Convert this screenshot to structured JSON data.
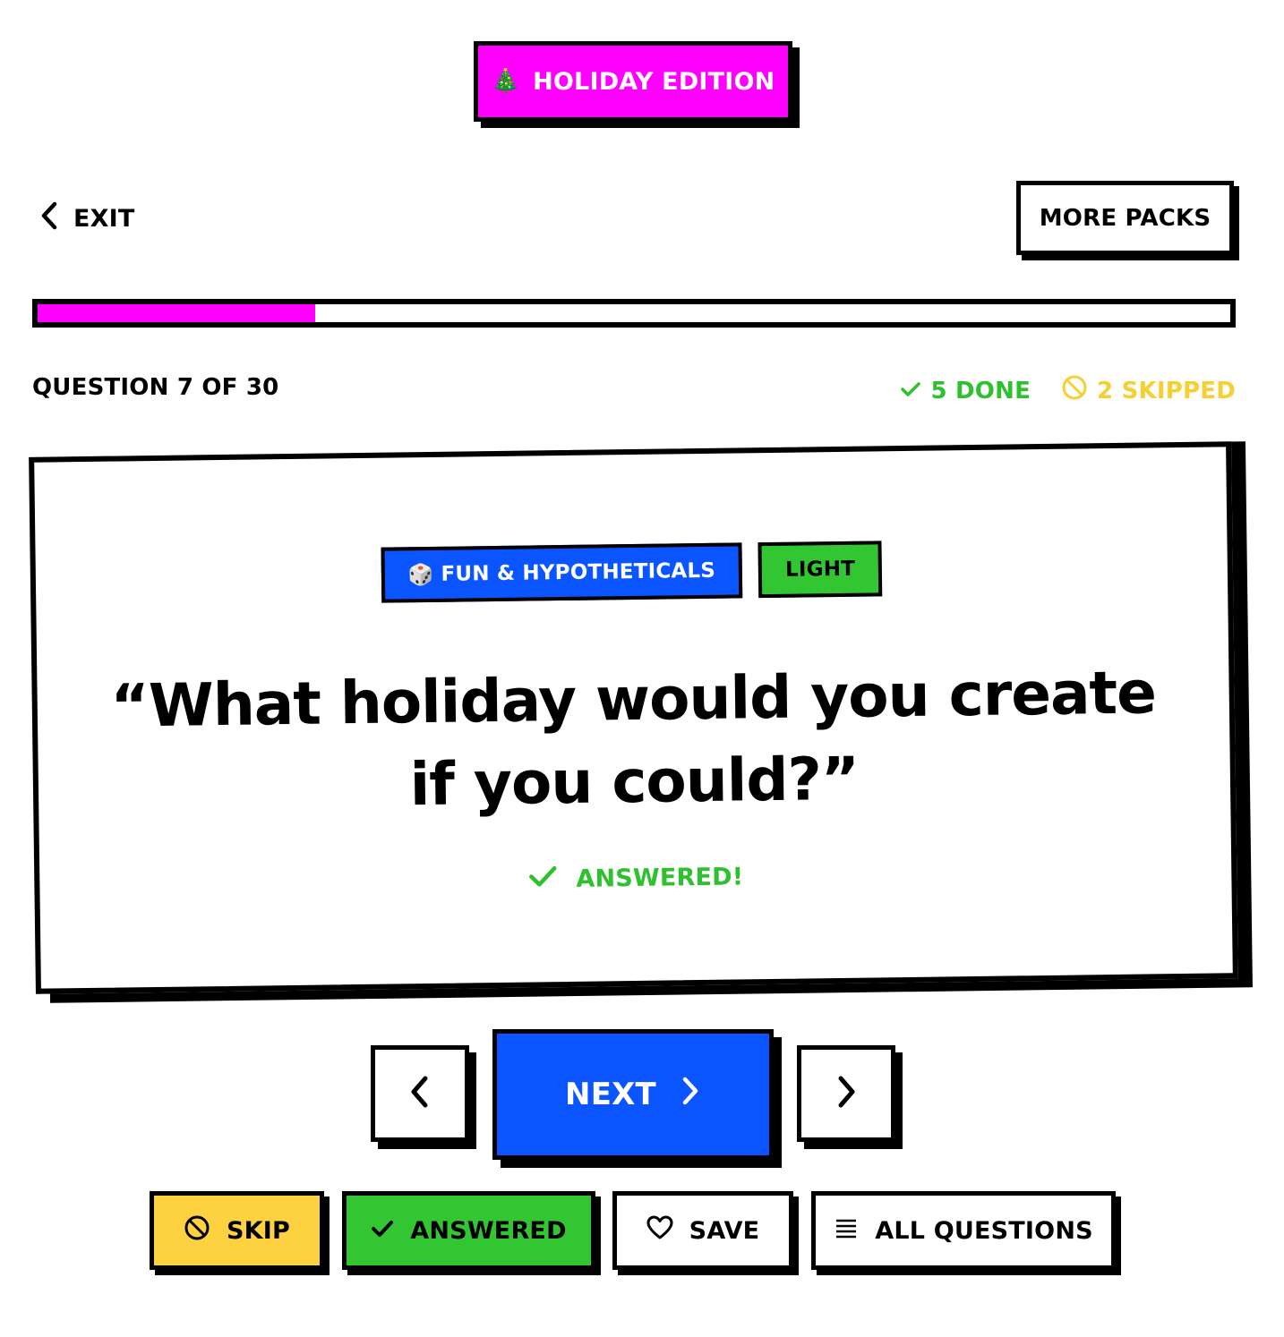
{
  "edition_badge": {
    "icon": "christmas-tree-icon",
    "emoji": "🎄",
    "label": "HOLIDAY EDITION"
  },
  "header": {
    "exit_label": "EXIT",
    "more_packs_label": "MORE PACKS"
  },
  "progress": {
    "fraction": 0.233
  },
  "status": {
    "question_counter": "QUESTION 7 OF 30",
    "done_label": "5 DONE",
    "skipped_label": "2 SKIPPED"
  },
  "card": {
    "category_emoji": "🎲",
    "category_label": "FUN & HYPOTHETICALS",
    "level_label": "LIGHT",
    "question": "“What holiday would you create if you could?”",
    "answered_label": "ANSWERED!"
  },
  "nav": {
    "next_label": "NEXT"
  },
  "actions": {
    "skip_label": "SKIP",
    "answered_label": "ANSWERED",
    "save_label": "SAVE",
    "all_questions_label": "ALL QUESTIONS"
  },
  "colors": {
    "magenta": "#ff00ff",
    "blue": "#0a55ff",
    "green": "#33c633",
    "green_text": "#2ec02e",
    "yellow": "#fdd140",
    "yellow_text": "#f6cf33"
  }
}
